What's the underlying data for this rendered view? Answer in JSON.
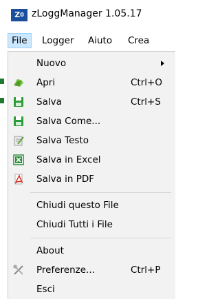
{
  "app": {
    "icon_text": "Z",
    "icon_sup": "0",
    "title": "zLoggManager 1.05.17"
  },
  "menubar": {
    "items": [
      {
        "label": "File"
      },
      {
        "label": "Logger"
      },
      {
        "label": "Aiuto"
      },
      {
        "label": "Crea"
      }
    ]
  },
  "file_menu": {
    "items": [
      {
        "label": "Nuovo",
        "shortcut": "",
        "icon": "none",
        "submenu": true
      },
      {
        "label": "Apri",
        "shortcut": "Ctrl+O",
        "icon": "open-folder-icon"
      },
      {
        "label": "Salva",
        "shortcut": "Ctrl+S",
        "icon": "save-icon"
      },
      {
        "label": "Salva Come...",
        "shortcut": "",
        "icon": "save-as-icon"
      },
      {
        "label": "Salva Testo",
        "shortcut": "",
        "icon": "text-document-icon"
      },
      {
        "label": "Salva in Excel",
        "shortcut": "",
        "icon": "excel-icon"
      },
      {
        "label": "Salva in PDF",
        "shortcut": "",
        "icon": "pdf-icon"
      },
      {
        "label": "Chiudi questo File",
        "shortcut": "",
        "icon": "none"
      },
      {
        "label": "Chiudi Tutti i File",
        "shortcut": "",
        "icon": "none"
      },
      {
        "label": "About",
        "shortcut": "",
        "icon": "none"
      },
      {
        "label": "Preferenze...",
        "shortcut": "Ctrl+P",
        "icon": "tools-icon"
      },
      {
        "label": "Esci",
        "shortcut": "",
        "icon": "none"
      }
    ]
  },
  "colors": {
    "icon_blue": "#1a4f9c",
    "menu_background": "#f2f2f2",
    "active_menu_highlight": "#cce8ff",
    "green": "#2e9c3a"
  }
}
